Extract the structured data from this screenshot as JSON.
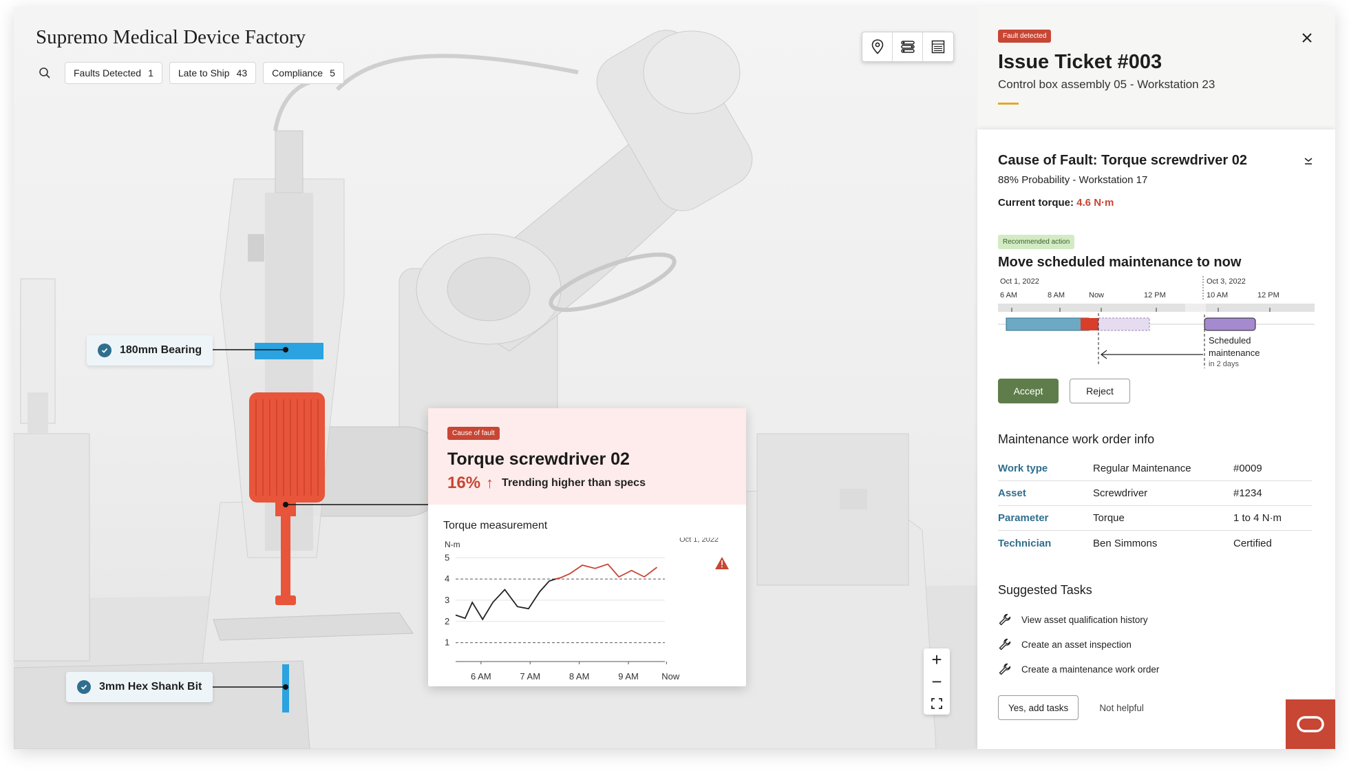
{
  "factory": {
    "title": "Supremo Medical Device Factory",
    "filters": [
      {
        "label": "Faults Detected",
        "count": "1"
      },
      {
        "label": "Late to Ship",
        "count": "43"
      },
      {
        "label": "Compliance",
        "count": "5"
      }
    ]
  },
  "toolbar": {
    "icons": [
      "location-pin-icon",
      "list-settings-icon",
      "calendar-grid-icon"
    ]
  },
  "callouts": {
    "bearing": "180mm Bearing",
    "hex_bit": "3mm Hex Shank Bit"
  },
  "fault_card": {
    "tag": "Cause of fault",
    "title": "Torque screwdriver 02",
    "percent": "16%",
    "arrow": "↑",
    "trend_text": "Trending higher than specs",
    "chart_title": "Torque measurement"
  },
  "chart_data": {
    "type": "line",
    "ylabel": "N-m",
    "date_label": "Oct 1, 2022",
    "ylim": [
      0.5,
      5.3
    ],
    "yticks": [
      "5",
      "4",
      "3",
      "2",
      "1"
    ],
    "xticks": [
      "6 AM",
      "7 AM",
      "8 AM",
      "9 AM",
      "Now"
    ],
    "threshold_upper": 4,
    "threshold_lower": 1,
    "series": [
      {
        "values_black": [
          2.3,
          2.15,
          2.9,
          2.1,
          2.9,
          3.5,
          2.7,
          2.6,
          3.4,
          3.9,
          4.0,
          4.05
        ]
      },
      {
        "values_red": [
          4.0,
          4.05,
          4.25,
          4.65,
          4.5,
          4.7,
          4.1,
          4.4,
          4.1,
          4.55
        ]
      }
    ],
    "x_black": [
      0,
      0.6,
      1.05,
      1.7,
      2.35,
      3.1,
      3.9,
      4.6,
      5.3,
      5.9,
      6.3,
      6.6
    ],
    "x_red": [
      6.3,
      6.6,
      7.2,
      8.0,
      8.8,
      9.6,
      10.3,
      11.1,
      11.9,
      12.7
    ]
  },
  "zoom": {
    "plus": "+",
    "minus": "−"
  },
  "ticket": {
    "tag": "Fault detected",
    "title": "Issue Ticket #003",
    "subtitle": "Control box assembly 05 - Workstation 23"
  },
  "cause": {
    "title": "Cause of Fault: Torque screwdriver 02",
    "subtitle": "88% Probability - Workstation 17",
    "torque_label": "Current torque:",
    "torque_value": "4.6 N·m"
  },
  "recommendation": {
    "tag": "Recommended action",
    "title": "Move scheduled maintenance to now",
    "date_left": "Oct 1, 2022",
    "date_right": "Oct 3, 2022",
    "times": [
      "6 AM",
      "8 AM",
      "Now",
      "12 PM",
      "10 AM",
      "12 PM"
    ],
    "scheduled_label_1": "Scheduled",
    "scheduled_label_2": "maintenance",
    "scheduled_label_3": "in 2 days",
    "accept": "Accept",
    "reject": "Reject"
  },
  "work_order": {
    "title": "Maintenance work order info",
    "rows": [
      {
        "key": "Work type",
        "value": "Regular Maintenance",
        "extra": "#0009"
      },
      {
        "key": "Asset",
        "value": "Screwdriver",
        "extra": "#1234"
      },
      {
        "key": "Parameter",
        "value": "Torque",
        "extra": "1 to 4 N·m"
      },
      {
        "key": "Technician",
        "value": "Ben Simmons",
        "extra": "Certified"
      }
    ]
  },
  "tasks": {
    "title": "Suggested Tasks",
    "items": [
      "View asset qualification history",
      "Create an asset inspection",
      "Create a maintenance work order"
    ],
    "yes": "Yes, add tasks",
    "no": "Not helpful"
  },
  "colors": {
    "accent_red": "#c74634",
    "accent_teal": "#2e6f8e",
    "accept_green": "#5e7d4a",
    "bearing_blue": "#2aa3e0",
    "tool_orange": "#e8553a"
  }
}
